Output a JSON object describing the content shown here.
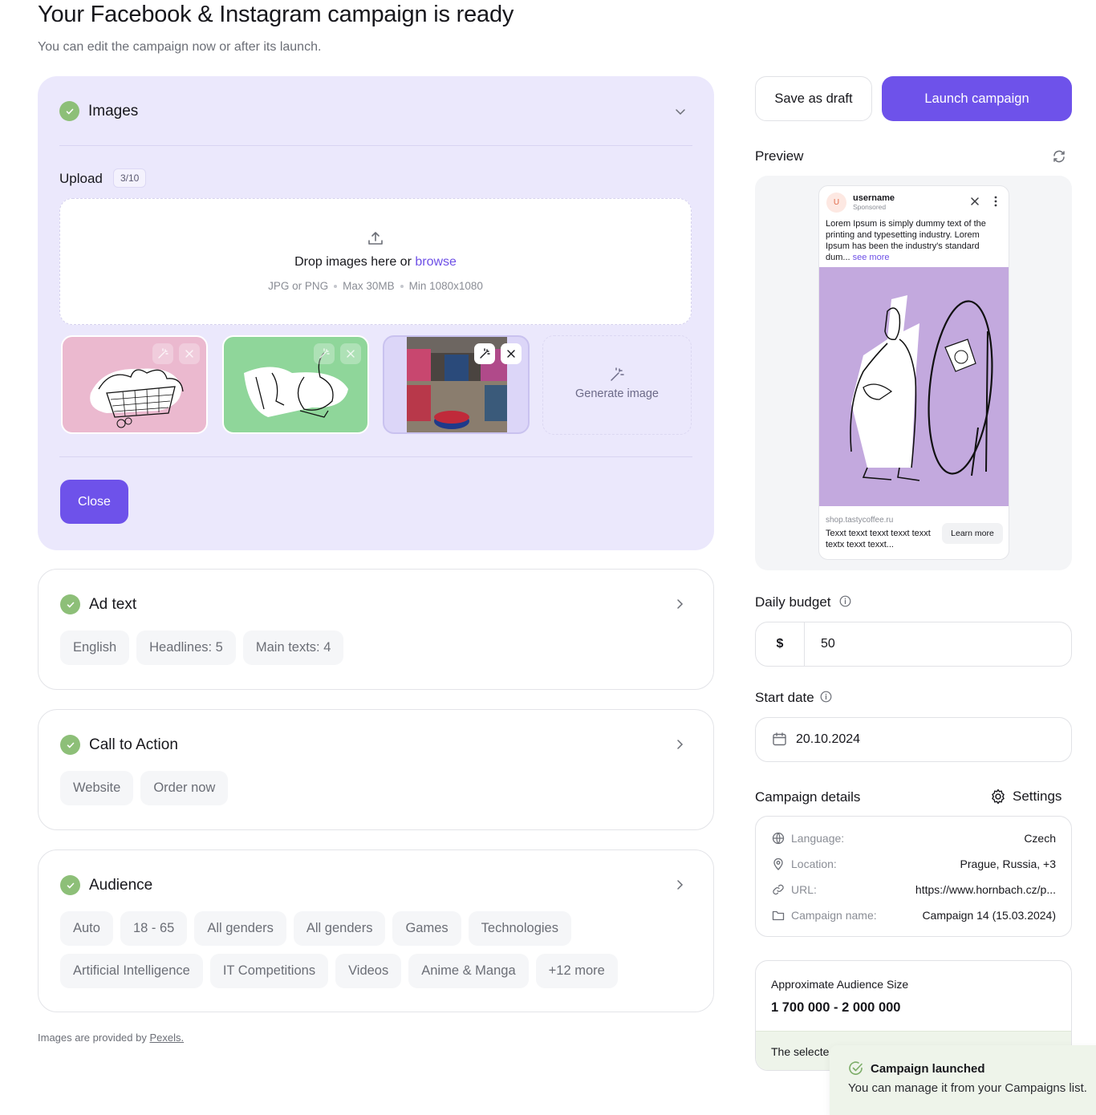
{
  "header": {
    "title": "Your Facebook & Instagram campaign is ready",
    "subtitle": "You can edit the campaign now or after its launch."
  },
  "images_section": {
    "title": "Images",
    "status": "complete",
    "expanded": true,
    "upload_label": "Upload",
    "upload_count": "3/10",
    "dropzone": {
      "text": "Drop images here or",
      "browse_link": "browse",
      "hints": [
        "JPG or PNG",
        "Max 30MB",
        "Min 1080x1080"
      ]
    },
    "thumbnails": [
      {
        "name": "dogs-in-basket-illustration",
        "background": "#ebb9cf"
      },
      {
        "name": "person-with-garlic-illustration",
        "background": "#8fd69a"
      },
      {
        "name": "store-interior-photo",
        "background": "#dcd6f8"
      }
    ],
    "generate_label": "Generate image",
    "close_label": "Close"
  },
  "ad_text_section": {
    "title": "Ad text",
    "status": "complete",
    "chips": [
      "English",
      "Headlines: 5",
      "Main texts: 4"
    ]
  },
  "cta_section": {
    "title": "Call to Action",
    "status": "complete",
    "chips": [
      "Website",
      "Order now"
    ]
  },
  "audience_section": {
    "title": "Audience",
    "status": "complete",
    "chips": [
      "Auto",
      "18 - 65",
      "All genders",
      "All genders",
      "Games",
      "Technologies",
      "Artificial Intelligence",
      "IT Competitions",
      "Videos",
      "Anime & Manga",
      "+12 more"
    ]
  },
  "footer": {
    "note": "Images are provided by",
    "link": "Pexels."
  },
  "actions": {
    "save_draft": "Save as draft",
    "launch": "Launch campaign"
  },
  "preview": {
    "label": "Preview",
    "ad": {
      "avatar_letter": "U",
      "username": "username",
      "sponsored": "Sponsored",
      "body": "Lorem Ipsum is simply dummy text of the printing and typesetting industry. Lorem Ipsum has been the industry's standard dum...",
      "see_more": "see more",
      "domain": "shop.tastycoffee.ru",
      "headline": "Texxt texxt texxt texxt texxt textx texxt texxt...",
      "cta": "Learn more"
    }
  },
  "daily_budget": {
    "label": "Daily budget",
    "currency": "$",
    "value": "50"
  },
  "start_date": {
    "label": "Start date",
    "value": "20.10.2024"
  },
  "campaign_details": {
    "label": "Campaign details",
    "settings_label": "Settings",
    "rows": [
      {
        "icon": "globe-icon",
        "label": "Language:",
        "value": "Czech"
      },
      {
        "icon": "location-pin-icon",
        "label": "Location:",
        "value": "Prague, Russia, +3"
      },
      {
        "icon": "link-icon",
        "label": "URL:",
        "value": "https://www.hornbach.cz/p..."
      },
      {
        "icon": "folder-icon",
        "label": "Campaign name:",
        "value": "Campaign 14 (15.03.2024)"
      }
    ]
  },
  "audience_size": {
    "label": "Approximate Audience Size",
    "value": "1 700 000 - 2 000 000",
    "footer_text": "The selecte"
  },
  "toast": {
    "title": "Campaign launched",
    "body": "You can manage it from your Campaigns list."
  },
  "colors": {
    "accent": "#6e52ea",
    "success": "#8dbf78",
    "open_card_bg": "#ebe8fc",
    "toast_bg": "#eef4ea"
  }
}
